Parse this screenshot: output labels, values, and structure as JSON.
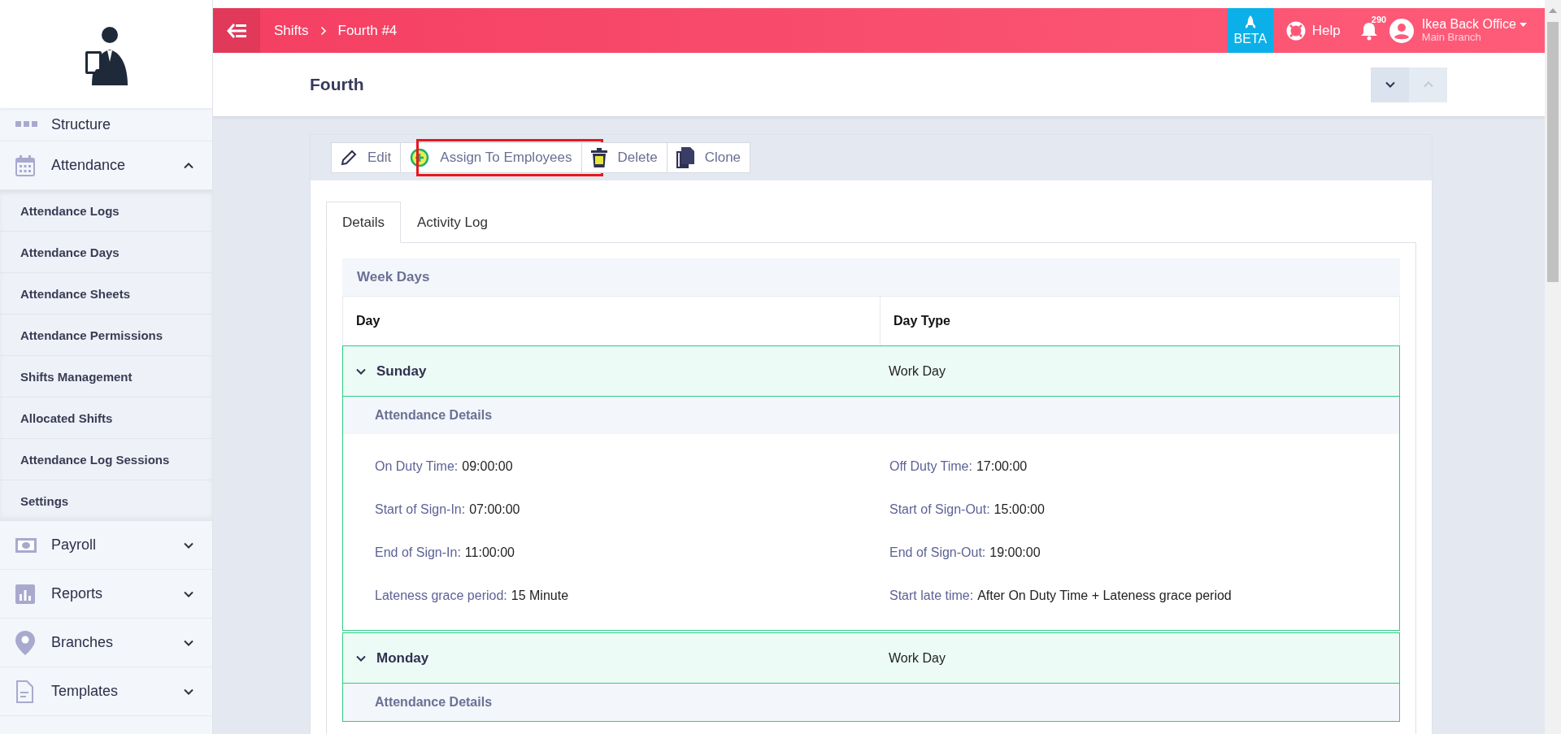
{
  "header": {
    "breadcrumb": [
      {
        "label": "Shifts"
      },
      {
        "label": "Fourth #4"
      }
    ],
    "beta": "BETA",
    "help": "Help",
    "notifications": "290",
    "user": {
      "name": "Ikea Back Office",
      "branch": "Main Branch"
    }
  },
  "sidebar": {
    "items": [
      {
        "label": "Structure",
        "kind": "link"
      },
      {
        "label": "Attendance",
        "kind": "group",
        "expanded": true,
        "children": [
          {
            "label": "Attendance Logs"
          },
          {
            "label": "Attendance Days"
          },
          {
            "label": "Attendance Sheets"
          },
          {
            "label": "Attendance Permissions"
          },
          {
            "label": "Shifts Management"
          },
          {
            "label": "Allocated Shifts"
          },
          {
            "label": "Attendance Log Sessions"
          },
          {
            "label": "Settings"
          }
        ]
      },
      {
        "label": "Payroll",
        "kind": "group",
        "expanded": false
      },
      {
        "label": "Reports",
        "kind": "group",
        "expanded": false
      },
      {
        "label": "Branches",
        "kind": "group",
        "expanded": false
      },
      {
        "label": "Templates",
        "kind": "group",
        "expanded": false
      }
    ]
  },
  "page_title": "Fourth",
  "toolbar": [
    {
      "label": "Edit",
      "highlighted": false
    },
    {
      "label": "Assign To Employees",
      "highlighted": true
    },
    {
      "label": "Delete",
      "highlighted": false
    },
    {
      "label": "Clone",
      "highlighted": false
    }
  ],
  "tabs": [
    {
      "label": "Details",
      "selected": true
    },
    {
      "label": "Activity Log",
      "selected": false
    }
  ],
  "week_days": {
    "title": "Week Days",
    "columns": [
      "Day",
      "Day Type"
    ],
    "rows": [
      {
        "day": "Sunday",
        "day_type": "Work Day",
        "expanded": true,
        "details_title": "Attendance Details",
        "fields": [
          {
            "label": "On Duty Time:",
            "value": "09:00:00"
          },
          {
            "label": "Off Duty Time:",
            "value": "17:00:00"
          },
          {
            "label": "Start of Sign-In:",
            "value": "07:00:00"
          },
          {
            "label": "Start of Sign-Out:",
            "value": "15:00:00"
          },
          {
            "label": "End of Sign-In:",
            "value": "11:00:00"
          },
          {
            "label": "End of Sign-Out:",
            "value": "19:00:00"
          },
          {
            "label": "Lateness grace period:",
            "value": "15 Minute"
          },
          {
            "label": "Start late time:",
            "value": "After On Duty Time + Lateness grace period"
          }
        ]
      },
      {
        "day": "Monday",
        "day_type": "Work Day",
        "expanded": true,
        "details_title": "Attendance Details"
      }
    ]
  }
}
